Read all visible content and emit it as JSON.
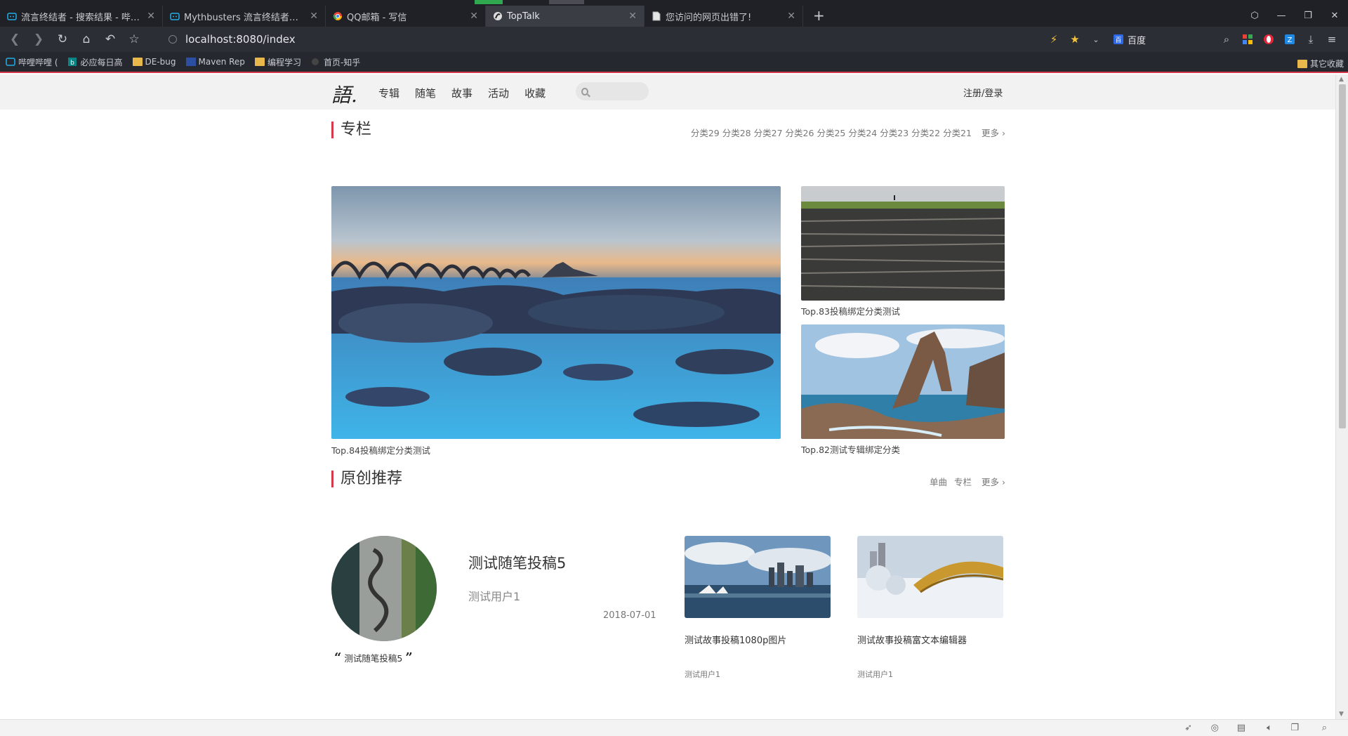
{
  "tabs": [
    {
      "label": "流言终结者 - 搜索结果 - 哔哩哔"
    },
    {
      "label": "Mythbusters 流言终结者高清系"
    },
    {
      "label": "QQ邮箱 - 写信"
    },
    {
      "label": "TopTalk"
    },
    {
      "label": "您访问的网页出错了!"
    }
  ],
  "address": {
    "url": "localhost:8080/index"
  },
  "search_engine": {
    "label": "百度",
    "icon_text": "百"
  },
  "bookmarks": [
    {
      "label": "哔哩哔哩 (",
      "icon": "bilibili-icon"
    },
    {
      "label": "必应每日高",
      "icon": "bing-icon"
    },
    {
      "label": "DE-bug",
      "icon": "folder-icon"
    },
    {
      "label": "Maven Rep",
      "icon": "maven-icon"
    },
    {
      "label": "编程学习",
      "icon": "folder-icon"
    },
    {
      "label": "首页-知乎",
      "icon": "zhihu-icon"
    }
  ],
  "bookmarks_other": "其它收藏",
  "site": {
    "logo": "語.",
    "nav": [
      "专辑",
      "随笔",
      "故事",
      "活动",
      "收藏"
    ],
    "login": "注册/登录"
  },
  "column": {
    "title": "专栏",
    "categories": [
      "分类29",
      "分类28",
      "分类27",
      "分类26",
      "分类25",
      "分类24",
      "分类23",
      "分类22",
      "分类21"
    ],
    "more": "更多",
    "items": [
      {
        "caption": "Top.84投稿绑定分类测试"
      },
      {
        "caption": "Top.83投稿绑定分类测试"
      },
      {
        "caption": "Top.82测试专辑绑定分类"
      }
    ]
  },
  "original": {
    "title": "原创推荐",
    "links": [
      "单曲",
      "专栏"
    ],
    "more": "更多",
    "essay": {
      "title": "测试随笔投稿5",
      "author": "测试用户1",
      "date": "2018-07-01",
      "quote": "测试随笔投稿5",
      "quote_open": "“",
      "quote_close": "”"
    },
    "stories": [
      {
        "title": "测试故事投稿1080p图片",
        "author": "测试用户1"
      },
      {
        "title": "测试故事投稿富文本编辑器",
        "author": "测试用户1"
      }
    ]
  },
  "colors": {
    "accent": "#d6394b",
    "chrome_dark": "#1f2126"
  }
}
